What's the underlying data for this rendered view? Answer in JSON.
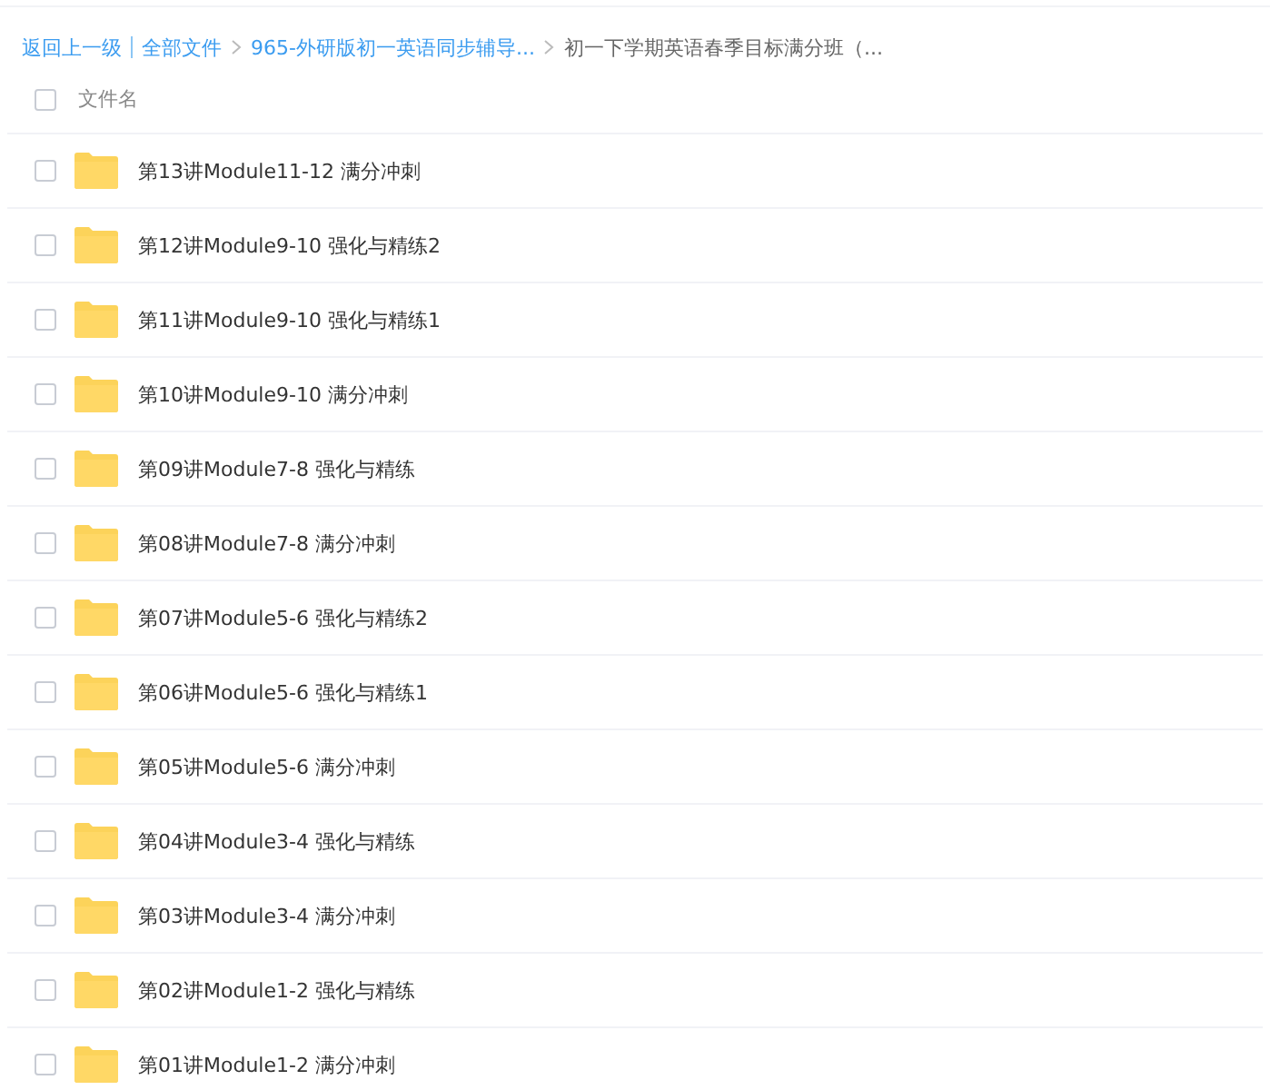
{
  "breadcrumb": {
    "links": [
      "返回上一级",
      "全部文件",
      "965-外研版初一英语同步辅导..."
    ],
    "current": "初一下学期英语春季目标满分班（..."
  },
  "header": {
    "label": "文件名",
    "checked": false
  },
  "files": [
    {
      "name": "第13讲Module11-12 满分冲刺",
      "checked": false
    },
    {
      "name": "第12讲Module9-10 强化与精练2",
      "checked": false
    },
    {
      "name": "第11讲Module9-10 强化与精练1",
      "checked": false
    },
    {
      "name": "第10讲Module9-10 满分冲刺",
      "checked": false
    },
    {
      "name": "第09讲Module7-8 强化与精练",
      "checked": false
    },
    {
      "name": "第08讲Module7-8 满分冲刺",
      "checked": false
    },
    {
      "name": "第07讲Module5-6 强化与精练2",
      "checked": false
    },
    {
      "name": "第06讲Module5-6 强化与精练1",
      "checked": false
    },
    {
      "name": "第05讲Module5-6 满分冲刺",
      "checked": false
    },
    {
      "name": "第04讲Module3-4 强化与精练",
      "checked": false
    },
    {
      "name": "第03讲Module3-4 满分冲刺",
      "checked": false
    },
    {
      "name": "第02讲Module1-2 强化与精练",
      "checked": false
    },
    {
      "name": "第01讲Module1-2 满分冲刺",
      "checked": false
    }
  ]
}
